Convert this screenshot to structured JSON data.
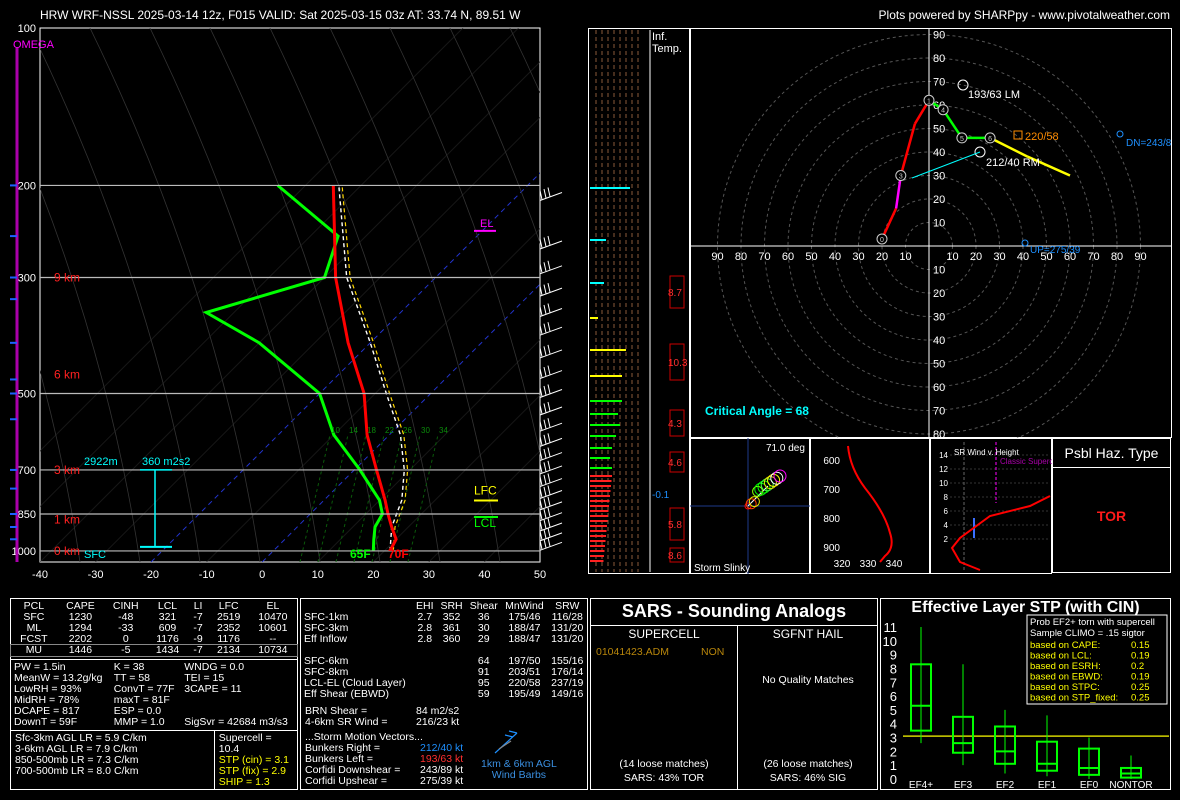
{
  "header": {
    "title": "HRW WRF-NSSL 2025-03-14 12z, F015  VALID: Sat 2025-03-15 03z  AT: 33.74 N, 89.51 W",
    "credit": "Plots powered by SHARPpy - www.pivotalweather.com"
  },
  "skewt": {
    "omega_label": "OMEGA",
    "p_labels": [
      "100",
      "200",
      "300",
      "500",
      "700",
      "850",
      "1000"
    ],
    "t_ticks": [
      "-40",
      "-30",
      "-20",
      "-10",
      "0",
      "10",
      "20",
      "30",
      "40",
      "50"
    ],
    "height_labels": [
      "9 km",
      "6 km",
      "3 km",
      "1 km",
      "0 km"
    ],
    "el_label": "EL",
    "lfc_label": "LFC",
    "lcl_label": "LCL",
    "sfc_label": "SFC",
    "td_label": "65F",
    "t_label": "70F",
    "eff_depth": "2922m",
    "eff_srh": "360 m2s2",
    "mix_ticks": [
      "10",
      "14",
      "18",
      "22",
      "26",
      "30",
      "34"
    ],
    "inf_temp": [
      "Inf.",
      "Temp."
    ],
    "inf_val": "-0.1",
    "theta_vals": [
      "8.7",
      "10.3",
      "4.3",
      "4.6",
      "5.8",
      "8.6"
    ]
  },
  "chart_data": [
    {
      "type": "line",
      "title": "Skew-T log-P",
      "temperature": {
        "p": [
          1000,
          950,
          900,
          850,
          800,
          700,
          600,
          500,
          400,
          300,
          200
        ],
        "t": [
          21,
          20,
          17,
          14,
          11,
          4,
          -4,
          -12,
          -24,
          -38,
          -55
        ]
      },
      "dewpoint": {
        "p": [
          1000,
          950,
          900,
          850,
          800,
          700,
          600,
          500,
          400,
          350,
          300,
          250,
          200
        ],
        "t": [
          18,
          16,
          14,
          13,
          10,
          1,
          -10,
          -20,
          -40,
          -55,
          -40,
          -45,
          -65
        ]
      },
      "parcel": {
        "p": [
          1000,
          900,
          800,
          700,
          600,
          500,
          400,
          300,
          200
        ],
        "t": [
          21,
          17,
          14,
          9,
          2,
          -8,
          -20,
          -36,
          -54
        ]
      }
    },
    {
      "type": "line",
      "title": "Hodograph",
      "axis_ticks": [
        "10",
        "20",
        "30",
        "40",
        "50",
        "60",
        "70",
        "80",
        "90"
      ],
      "hodo_labels": {
        "lm": "193/63 LM",
        "rm": "212/40 RM",
        "mw": "220/58",
        "dn": "DN=243/8",
        "up": "UP=275/39",
        "crit": "Critical Angle = 68"
      },
      "points": [
        [
          -20,
          3
        ],
        [
          -14,
          16
        ],
        [
          -12,
          30
        ],
        [
          -6,
          52
        ],
        [
          0,
          62
        ],
        [
          6,
          58
        ],
        [
          14,
          46
        ],
        [
          26,
          46
        ],
        [
          42,
          38
        ],
        [
          60,
          30
        ]
      ],
      "markers": [
        "0",
        "1",
        "3",
        "4",
        "5",
        "6"
      ]
    },
    {
      "type": "line",
      "title": "Storm Slinky / SR Wind",
      "slinky_label": "Storm Slinky",
      "slinky_deg": "71.0 deg",
      "theta_ticks_y": [
        "600",
        "700",
        "800",
        "900"
      ],
      "theta_ticks_x": [
        "320",
        "330",
        "340"
      ],
      "srw_title": "SR Wind v. Height",
      "srw_classic": "Classic Supercell",
      "srw_y": [
        "14",
        "12",
        "10",
        "8",
        "6",
        "4",
        "2"
      ]
    },
    {
      "type": "bar",
      "title": "Effective Layer STP (with CIN)",
      "categories": [
        "EF4+",
        "EF3",
        "EF2",
        "EF1",
        "EF0",
        "NONTOR"
      ],
      "y_ticks": [
        "0",
        "1",
        "2",
        "3",
        "4",
        "5",
        "6",
        "7",
        "8",
        "9",
        "10",
        "11"
      ],
      "boxes": [
        {
          "lo": 2.6,
          "q1": 3.5,
          "med": 5.3,
          "q3": 8.3,
          "hi": 11.0
        },
        {
          "lo": 1.0,
          "q1": 1.9,
          "med": 2.6,
          "q3": 4.5,
          "hi": 8.3
        },
        {
          "lo": 0.4,
          "q1": 1.1,
          "med": 2.0,
          "q3": 3.8,
          "hi": 5.0
        },
        {
          "lo": 0.2,
          "q1": 0.6,
          "med": 1.1,
          "q3": 2.7,
          "hi": 4.6
        },
        {
          "lo": 0.0,
          "q1": 0.3,
          "med": 0.8,
          "q3": 2.2,
          "hi": 3.0
        },
        {
          "lo": 0.0,
          "q1": 0.1,
          "med": 0.4,
          "q3": 0.8,
          "hi": 1.7
        }
      ],
      "stp_value": 3.1,
      "box_text": [
        "Prob EF2+ torn with supercell",
        "Sample CLIMO = .15 sigtor"
      ],
      "probs": [
        [
          "based on CAPE:",
          "0.15"
        ],
        [
          "based on LCL:",
          "0.19"
        ],
        [
          "based on ESRH:",
          "0.2"
        ],
        [
          "based on EBWD:",
          "0.19"
        ],
        [
          "based on STPC:",
          "0.25"
        ],
        [
          "based on STP_fixed:",
          "0.25"
        ]
      ]
    }
  ],
  "hazard": {
    "title": "Psbl Haz. Type",
    "value": "TOR"
  },
  "parcel_table": {
    "headers": [
      "PCL",
      "CAPE",
      "CINH",
      "LCL",
      "LI",
      "LFC",
      "EL"
    ],
    "rows": [
      [
        "SFC",
        "1230",
        "-48",
        "321",
        "-7",
        "2519",
        "10470"
      ],
      [
        "ML",
        "1294",
        "-33",
        "609",
        "-7",
        "2352",
        "10601"
      ],
      [
        "FCST",
        "2202",
        "0",
        "1176",
        "-9",
        "1176",
        "--"
      ],
      [
        "MU",
        "1446",
        "-5",
        "1434",
        "-7",
        "2134",
        "10734"
      ]
    ]
  },
  "indices": [
    [
      "PW = 1.5in",
      "K = 38",
      "WNDG = 0.0"
    ],
    [
      "MeanW = 13.2g/kg",
      "TT = 58",
      "TEI = 15"
    ],
    [
      "LowRH = 93%",
      "ConvT = 77F",
      "3CAPE = 11"
    ],
    [
      "MidRH = 78%",
      "maxT = 81F",
      ""
    ],
    [
      "DCAPE = 817",
      "ESP = 0.0",
      ""
    ],
    [
      "DownT = 59F",
      "MMP = 1.0",
      "SigSvr = 42684 m3/s3"
    ]
  ],
  "lapse_rates": [
    "Sfc-3km AGL LR = 5.9 C/km",
    "3-6km AGL LR = 7.9 C/km",
    "850-500mb LR = 7.3 C/km",
    "700-500mb LR = 8.0 C/km"
  ],
  "composites": [
    "Supercell = 10.4",
    "STP (cin) = 3.1",
    "STP (fix) = 2.9",
    "SHIP = 1.3"
  ],
  "kin_table": {
    "headers": [
      "",
      "EHI",
      "SRH",
      "Shear",
      "MnWind",
      "SRW"
    ],
    "rows": [
      [
        "SFC-1km",
        "2.7",
        "352",
        "36",
        "175/46",
        "116/28"
      ],
      [
        "SFC-3km",
        "2.8",
        "361",
        "30",
        "188/47",
        "131/20"
      ],
      [
        "Eff Inflow",
        "2.8",
        "360",
        "29",
        "188/47",
        "131/20"
      ],
      [
        "",
        "",
        "",
        "",
        "",
        ""
      ],
      [
        "SFC-6km",
        "",
        "",
        "64",
        "197/50",
        "155/16"
      ],
      [
        "SFC-8km",
        "",
        "",
        "91",
        "203/51",
        "176/14"
      ],
      [
        "LCL-EL (Cloud Layer)",
        "",
        "",
        "95",
        "220/58",
        "237/19"
      ],
      [
        "Eff Shear (EBWD)",
        "",
        "",
        "59",
        "195/49",
        "149/16"
      ]
    ],
    "brn": [
      "BRN Shear =",
      "84 m2/s2"
    ],
    "srw46": [
      "4-6km SR Wind =",
      "216/23 kt"
    ],
    "storm_motion": "...Storm Motion Vectors...",
    "motion": [
      [
        "Bunkers Right =",
        "212/40 kt"
      ],
      [
        "Bunkers Left =",
        "193/63 kt"
      ],
      [
        "Corfidi Downshear =",
        "243/89 kt"
      ],
      [
        "Corfidi Upshear =",
        "275/39 kt"
      ]
    ],
    "barb_note": [
      "1km & 6km AGL",
      "Wind Barbs"
    ]
  },
  "sars": {
    "title": "SARS - Sounding Analogs",
    "supercell": "SUPERCELL",
    "hail": "SGFNT HAIL",
    "match_date": "01041423.ADM",
    "match_type": "NON",
    "no_match": "No Quality Matches",
    "sup_loose": "(14 loose matches)",
    "sup_pct": "SARS: 43% TOR",
    "hail_loose": "(26 loose matches)",
    "hail_pct": "SARS: 46% SIG"
  },
  "colors": {
    "temp": "#ff0000",
    "dew": "#00ff00",
    "cyan": "#00ffff",
    "yellow": "#ffff00",
    "magenta": "#ff00ff",
    "orange": "#ff8c00"
  }
}
